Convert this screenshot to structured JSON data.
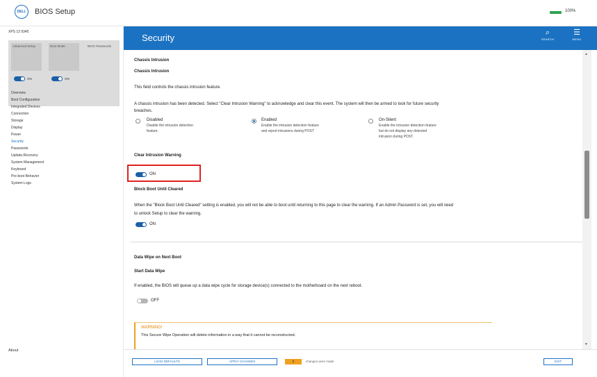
{
  "app": {
    "logo_text": "DELL",
    "title": "BIOS Setup",
    "battery_pct": "100%"
  },
  "sidebar": {
    "model": "XPS 13 9345",
    "quick_tiles": [
      {
        "label": "Advanced Setup"
      },
      {
        "label": "Boot Mode"
      },
      {
        "label": "BIOS Passwords"
      }
    ],
    "quick_toggles": [
      {
        "state": "ON"
      },
      {
        "state": "ON"
      }
    ],
    "items": [
      {
        "label": "Overview"
      },
      {
        "label": "Boot Configuration"
      },
      {
        "label": "Integrated Devices"
      },
      {
        "label": "Connection"
      },
      {
        "label": "Storage"
      },
      {
        "label": "Display"
      },
      {
        "label": "Power"
      },
      {
        "label": "Security"
      },
      {
        "label": "Passwords"
      },
      {
        "label": "Update,Recovery"
      },
      {
        "label": "System Management"
      },
      {
        "label": "Keyboard"
      },
      {
        "label": "Pre-boot Behavior"
      },
      {
        "label": "System Logs"
      }
    ],
    "active_item": "Security",
    "about": "About"
  },
  "header": {
    "title": "Security",
    "search_label": "SEARCH",
    "menu_label": "MENU",
    "accent": "#1b72c2"
  },
  "content": {
    "chassis": {
      "section_title": "Chassis Intrusion",
      "setting_title": "Chassis Intrusion",
      "description": "This field controls the chassis intrusion feature.",
      "alert_line1": "A chassis intrusion has been detected. Select \"Clear Intrusion Warning\" to acknowledge and clear this event. The system will then be armed to look for future security",
      "alert_line2": "breaches.",
      "options": [
        {
          "label": "Disabled",
          "desc1": "Disable the intrusion detection",
          "desc2": "feature."
        },
        {
          "label": "Enabled",
          "desc1": "Enable the intrusion detection feature",
          "desc2": "and report intrusions during POST"
        },
        {
          "label": "On-Silent",
          "desc1": "Enable the intrusion detection feature",
          "desc2": "but do not display any detected",
          "desc3": "intrusion during POST."
        }
      ],
      "selected": "Enabled"
    },
    "clear_warning": {
      "title": "Clear Intrusion Warning",
      "state": "ON"
    },
    "block_boot": {
      "title": "Block Boot Until Cleared",
      "desc_line1": "When the \"Block Boot Until Cleared\" setting is enabled, you will not be able to boot until returning to this page to clear the warning. If an Admin Password is set, you will need",
      "desc_line2": "to unlock Setup to clear the warning.",
      "state": "ON"
    },
    "data_wipe": {
      "section_title": "Data Wipe on Next Boot",
      "setting_title": "Start Data Wipe",
      "description": "If enabled, the BIOS will queue up a data wipe cycle for storage device(s) connected to the motherboard on the next reboot.",
      "state": "OFF"
    },
    "warning": {
      "title": "WARNING!",
      "text": "This Secure Wipe Operation will delete information in a way that it cannot be reconstructed."
    }
  },
  "footer": {
    "load_defaults": "LOAD DEFAULTS",
    "apply_changes": "APPLY CHANGES",
    "changes_count": "0",
    "changes_text": "changes were made",
    "exit": "EXIT"
  }
}
